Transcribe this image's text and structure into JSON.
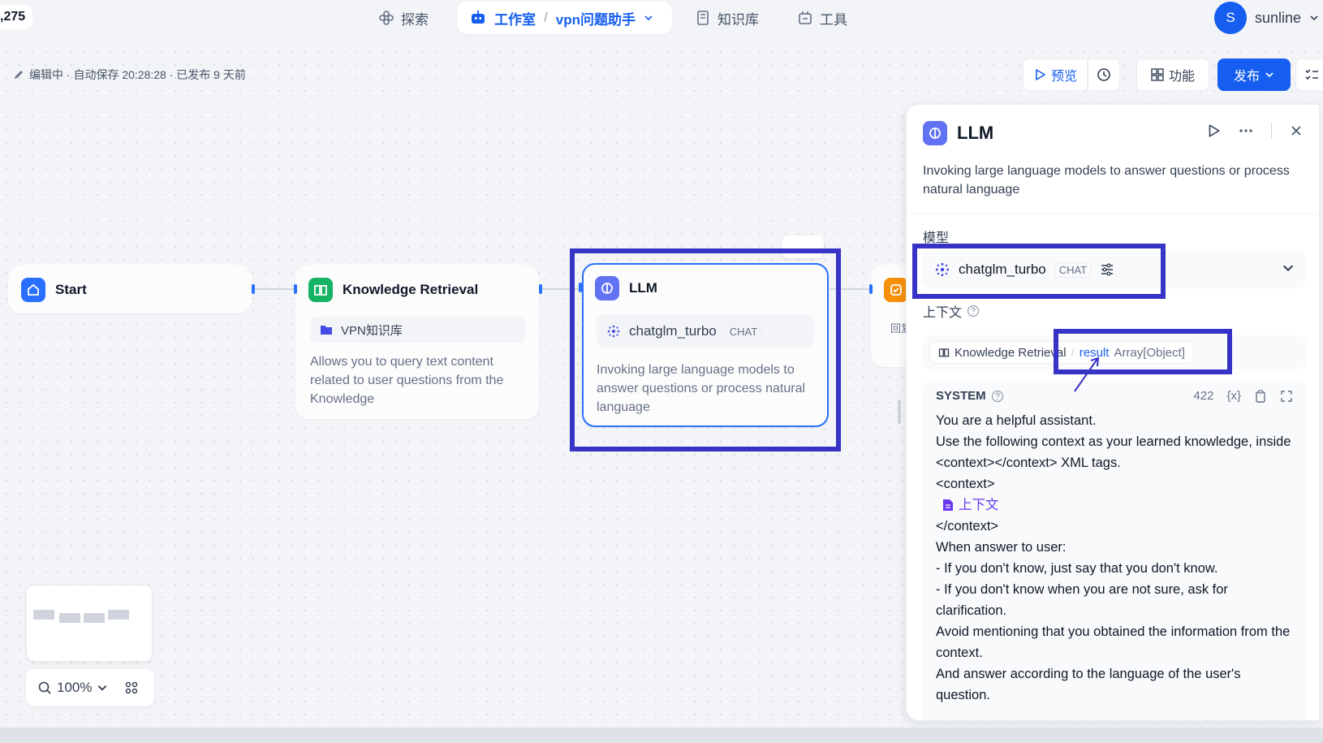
{
  "header": {
    "counter": ",275",
    "nav": {
      "explore": "探索",
      "studio": "工作室",
      "app_name": "vpn问题助手",
      "knowledge": "知识库",
      "tools": "工具"
    },
    "user": {
      "initial": "S",
      "name": "sunline"
    }
  },
  "editor": {
    "status": "编辑中 · 自动保存 20:28:28 · 已发布 9 天前",
    "preview_label": "预览",
    "features_label": "功能",
    "publish_label": "发布"
  },
  "nodes": {
    "start": {
      "title": "Start"
    },
    "knowledge_retrieval": {
      "title": "Knowledge Retrieval",
      "dataset": "VPN知识库",
      "description": "Allows you to query text content related to user questions from the Knowledge"
    },
    "llm": {
      "title": "LLM",
      "model": "chatglm_turbo",
      "model_tag": "CHAT",
      "description": "Invoking large language models to answer questions or process natural language"
    },
    "answer": {
      "title_stub": "回复"
    }
  },
  "zoom": {
    "level": "100%"
  },
  "panel": {
    "title": "LLM",
    "description": "Invoking large language models to answer questions or process natural language",
    "model_label": "模型",
    "model": "chatglm_turbo",
    "model_tag": "CHAT",
    "context_label": "上下文",
    "context_var": {
      "node": "Knowledge Retrieval",
      "name": "result",
      "type": "Array[Object]"
    },
    "prompt": {
      "role": "SYSTEM",
      "token_count": "422",
      "var_button": "{x}",
      "lines": [
        "You are a helpful assistant.",
        "Use the following context as your learned knowledge, inside <context></context> XML tags.",
        "<context>",
        "上下文",
        "</context>",
        "When answer to user:",
        "- If you don't know, just say that you don't know.",
        "- If you don't know when you are not sure, ask for clarification.",
        "Avoid mentioning that you obtained the information from the context.",
        "And answer according to the language of the user's question."
      ]
    }
  },
  "colors": {
    "accent": "#155eef",
    "annotation": "#3733c6",
    "start_icon": "#2970ff",
    "kr_icon": "#16b364",
    "llm_icon": "#6172f3",
    "answer_icon": "#f79009"
  }
}
